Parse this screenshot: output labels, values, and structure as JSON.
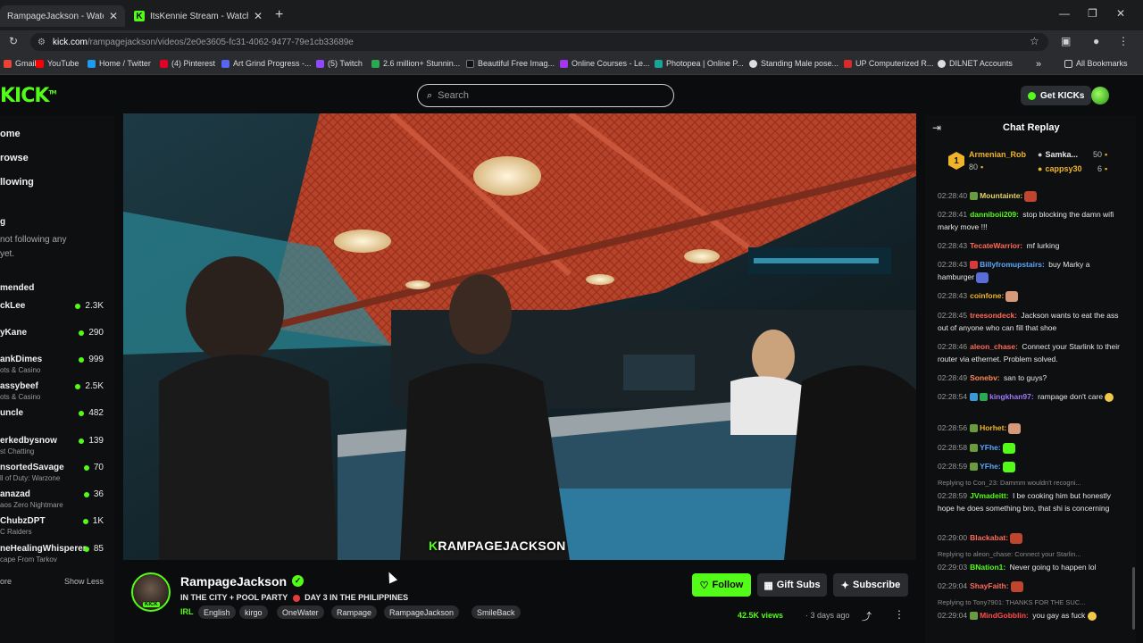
{
  "browser": {
    "tabs": [
      {
        "label": "RampageJackson - Watch the V...",
        "active": true
      },
      {
        "label": "ItsKennie Stream - Watch Live ...",
        "active": false
      }
    ],
    "url_host": "kick.com",
    "url_path": "/rampagejackson/videos/2e0e3605-fc31-4062-9477-79e1cb33689e",
    "bookmarks": [
      {
        "label": "Gmail",
        "color": "#ea4335"
      },
      {
        "label": "YouTube",
        "color": "#ff0000"
      },
      {
        "label": "Home / Twitter",
        "color": "#1d9bf0"
      },
      {
        "label": "(4) Pinterest",
        "color": "#e60023"
      },
      {
        "label": "Art Grind Progress -...",
        "color": "#5865f2"
      },
      {
        "label": "(5) Twitch",
        "color": "#9146ff"
      },
      {
        "label": "2.6 million+ Stunnin...",
        "color": "#2aa952"
      },
      {
        "label": "Beautiful Free Imag...",
        "color": "#111111"
      },
      {
        "label": "Online Courses - Le...",
        "color": "#a435f0"
      },
      {
        "label": "Photopea | Online P...",
        "color": "#18a497"
      },
      {
        "label": "Standing Male pose...",
        "color": "#dddddd"
      },
      {
        "label": "UP Computerized R...",
        "color": "#d62b2b"
      },
      {
        "label": "DILNET Accounts",
        "color": "#dddddd"
      }
    ],
    "all_bookmarks": "All Bookmarks"
  },
  "kick": {
    "logo": "KICK",
    "search_placeholder": "Search",
    "get_kicks": "Get KICKs"
  },
  "sidebar": {
    "nav": [
      "ome",
      "rowse",
      "llowing"
    ],
    "section_following": "g",
    "following_note_1": "not following any",
    "following_note_2": "yet.",
    "section_recommended": "mended",
    "channels": [
      {
        "name": "ckLee",
        "category": "",
        "viewers": "2.3K"
      },
      {
        "name": "yKane",
        "category": "",
        "viewers": "290"
      },
      {
        "name": "ankDimes",
        "category": "ots & Casino",
        "viewers": "999"
      },
      {
        "name": "assybeef",
        "category": "ots & Casino",
        "viewers": "2.5K"
      },
      {
        "name": "uncle",
        "category": "",
        "viewers": "482"
      },
      {
        "name": "erkedbysnow",
        "category": "st Chatting",
        "viewers": "139"
      },
      {
        "name": "nsortedSavage",
        "category": "ll of Duty: Warzone",
        "viewers": "70"
      },
      {
        "name": "anazad",
        "category": "aos Zero Nightmare",
        "viewers": "36"
      },
      {
        "name": "ChubzDPT",
        "category": "C Raiders",
        "viewers": "1K"
      },
      {
        "name": "neHealingWhisperer",
        "category": "cape From Tarkov",
        "viewers": "85"
      }
    ],
    "show_more": "ore",
    "show_less": "Show Less"
  },
  "video": {
    "overlay": "RAMPAGEJACKSON"
  },
  "stream": {
    "name": "RampageJackson",
    "title_a": "IN THE CITY + POOL PARTY",
    "title_b": "DAY 3 IN THE PHILIPPINES",
    "category": "IRL",
    "tags": [
      "English",
      "kirgo",
      "OneWater",
      "Rampage",
      "RampageJackson",
      "SmileBack"
    ],
    "follow": "Follow",
    "gift_subs": "Gift Subs",
    "subscribe": "Subscribe",
    "views": "42.5K views",
    "ago": "3 days ago"
  },
  "chat": {
    "title": "Chat Replay",
    "gifters": [
      {
        "name": "Armenian_Rob",
        "amount": "80",
        "color": "#f0b429"
      },
      {
        "name": "Samka...",
        "amount": "50",
        "color": "#e8e8e8"
      },
      {
        "name": "cappsy30",
        "amount": "6",
        "color": "#f0b429"
      }
    ],
    "messages": [
      {
        "time": "02:28:40",
        "user": "Mountainte:",
        "ucolor": "#e6d36b",
        "text": "",
        "emote": "#c0452e"
      },
      {
        "time": "02:28:41",
        "user": "danniboii209:",
        "ucolor": "#53fc18",
        "text": "stop blocking the damn wifi marky move !!!",
        "emote": ""
      },
      {
        "time": "02:28:43",
        "user": "TecateWarrior:",
        "ucolor": "#ff6a5a",
        "text": "mf lurking",
        "emote": ""
      },
      {
        "time": "02:28:43",
        "user": "Billyfromupstairs:",
        "ucolor": "#5aa7ff",
        "text": "buy Marky a hamburger",
        "emote": "#5a6cd9"
      },
      {
        "time": "02:28:43",
        "user": "coinfone:",
        "ucolor": "#f0b429",
        "text": "",
        "emote": "#d69a7a"
      },
      {
        "time": "02:28:45",
        "user": "treesondeck:",
        "ucolor": "#ff6a5a",
        "text": "Jackson wants to eat the ass out of anyone who can fill that shoe",
        "emote": ""
      },
      {
        "time": "02:28:46",
        "user": "aleon_chase:",
        "ucolor": "#ff6a5a",
        "text": "Connect your Starlink to their router via ethernet. Problem solved.",
        "emote": ""
      },
      {
        "time": "02:28:49",
        "user": "Sonebv:",
        "ucolor": "#ff8a5a",
        "text": "san to guys?",
        "emote": ""
      },
      {
        "time": "02:28:54",
        "user": "kingkhan97:",
        "ucolor": "#a276ff",
        "text": "rampage don't care",
        "emote": "#f0c94a"
      },
      {
        "time": "02:28:56",
        "user": "Horhet:",
        "ucolor": "#f0b429",
        "text": "",
        "emote": "#d69a7a"
      },
      {
        "time": "02:28:58",
        "user": "YFhe:",
        "ucolor": "#5aa7ff",
        "text": "",
        "emote": "#53fc18"
      },
      {
        "time": "02:28:59",
        "user": "YFhe:",
        "ucolor": "#5aa7ff",
        "text": "",
        "emote": "#53fc18"
      },
      {
        "time": "02:28:59",
        "user": "JVmadeitt:",
        "ucolor": "#53fc18",
        "text": "I be cooking him but honestly hope he does something bro, that shi is concerning",
        "emote": "",
        "reply": "Replying to Con_23: Dammm wouldn't recogni..."
      },
      {
        "time": "02:29:00",
        "user": "Blackabat:",
        "ucolor": "#ff6a5a",
        "text": "",
        "emote": "#c0452e"
      },
      {
        "time": "02:29:03",
        "user": "BNation1:",
        "ucolor": "#53fc18",
        "text": "Never going to happen lol",
        "emote": "",
        "reply": "Replying to aleon_chase: Connect your Starlin..."
      },
      {
        "time": "02:29:04",
        "user": "ShayFaith:",
        "ucolor": "#ff6a5a",
        "text": "",
        "emote": "#c0452e"
      },
      {
        "time": "02:29:04",
        "user": "MindGobblin:",
        "ucolor": "#ff4a4a",
        "text": "you gay as fuck",
        "emote": "#f0c94a",
        "reply": "Replying to Tony7901: THANKS FOR THE SUC..."
      }
    ]
  }
}
